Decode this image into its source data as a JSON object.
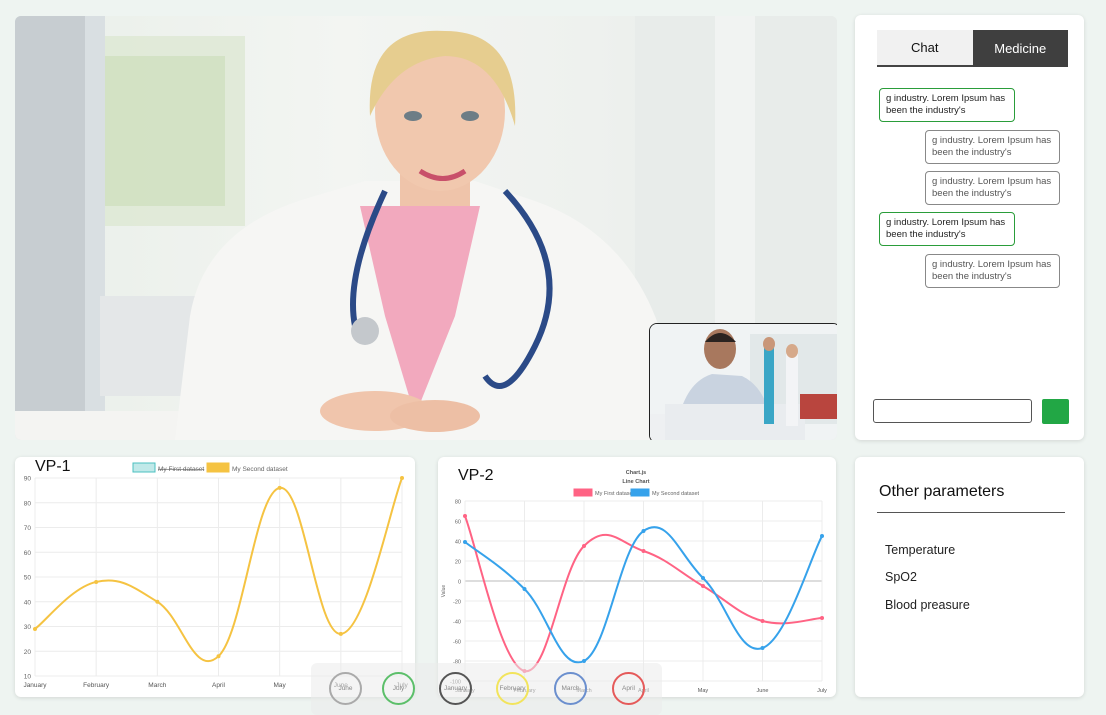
{
  "chat": {
    "tabs": [
      "Chat",
      "Medicine"
    ],
    "messages": [
      {
        "side": "left",
        "text": "g industry. Lorem Ipsum has been the industry's"
      },
      {
        "side": "right",
        "text": "g industry. Lorem Ipsum has been the industry's"
      },
      {
        "side": "right",
        "text": "g industry. Lorem Ipsum has been the industry's"
      },
      {
        "side": "left",
        "text": "g industry. Lorem Ipsum has been the industry's"
      },
      {
        "side": "right",
        "text": "g industry. Lorem Ipsum has been the industry's"
      }
    ],
    "input_value": "",
    "send_color": "#22a745"
  },
  "vp1": {
    "title": "VP-1"
  },
  "vp2": {
    "title": "VP-2"
  },
  "params": {
    "title": "Other parameters",
    "items": [
      "Temperature",
      "SpO2",
      "Blood preasure"
    ]
  },
  "overlay": {
    "months": [
      {
        "label": "June",
        "color": "#aaaaaa"
      },
      {
        "label": "July",
        "color": "#5cbf6a"
      },
      {
        "label": "January",
        "color": "#555555"
      },
      {
        "label": "February",
        "color": "#f2e45c"
      },
      {
        "label": "March",
        "color": "#6b8fce"
      },
      {
        "label": "April",
        "color": "#e55a5a"
      }
    ]
  },
  "chart_data": [
    {
      "type": "line",
      "categories": [
        "January",
        "February",
        "March",
        "April",
        "May",
        "June",
        "July"
      ],
      "series": [
        {
          "name": "My First dataset",
          "values": [],
          "color": "#4bc0c0",
          "hidden": true
        },
        {
          "name": "My Second dataset",
          "values": [
            29,
            48,
            40,
            18,
            86,
            27,
            90
          ],
          "color": "#f5c342"
        }
      ],
      "ylim": [
        10,
        90
      ],
      "yticks": [
        10,
        20,
        30,
        40,
        50,
        60,
        70,
        80,
        90
      ],
      "legend": "top",
      "grid": true
    },
    {
      "type": "line",
      "title": "Chart.js",
      "subtitle": "Line Chart",
      "categories": [
        "January",
        "February",
        "March",
        "April",
        "May",
        "June",
        "July"
      ],
      "series": [
        {
          "name": "My First dataset",
          "values": [
            65,
            -90,
            35,
            30,
            -5,
            -40,
            -37
          ],
          "color": "#ff6384"
        },
        {
          "name": "My Second dataset",
          "values": [
            39,
            -8,
            -80,
            50,
            3,
            -67,
            45
          ],
          "color": "#36a2eb"
        }
      ],
      "ylabel": "Value",
      "ylim": [
        -100,
        80
      ],
      "yticks": [
        -100,
        -80,
        -60,
        -40,
        -20,
        0,
        20,
        40,
        60,
        80
      ],
      "legend": "top",
      "grid": true
    }
  ]
}
